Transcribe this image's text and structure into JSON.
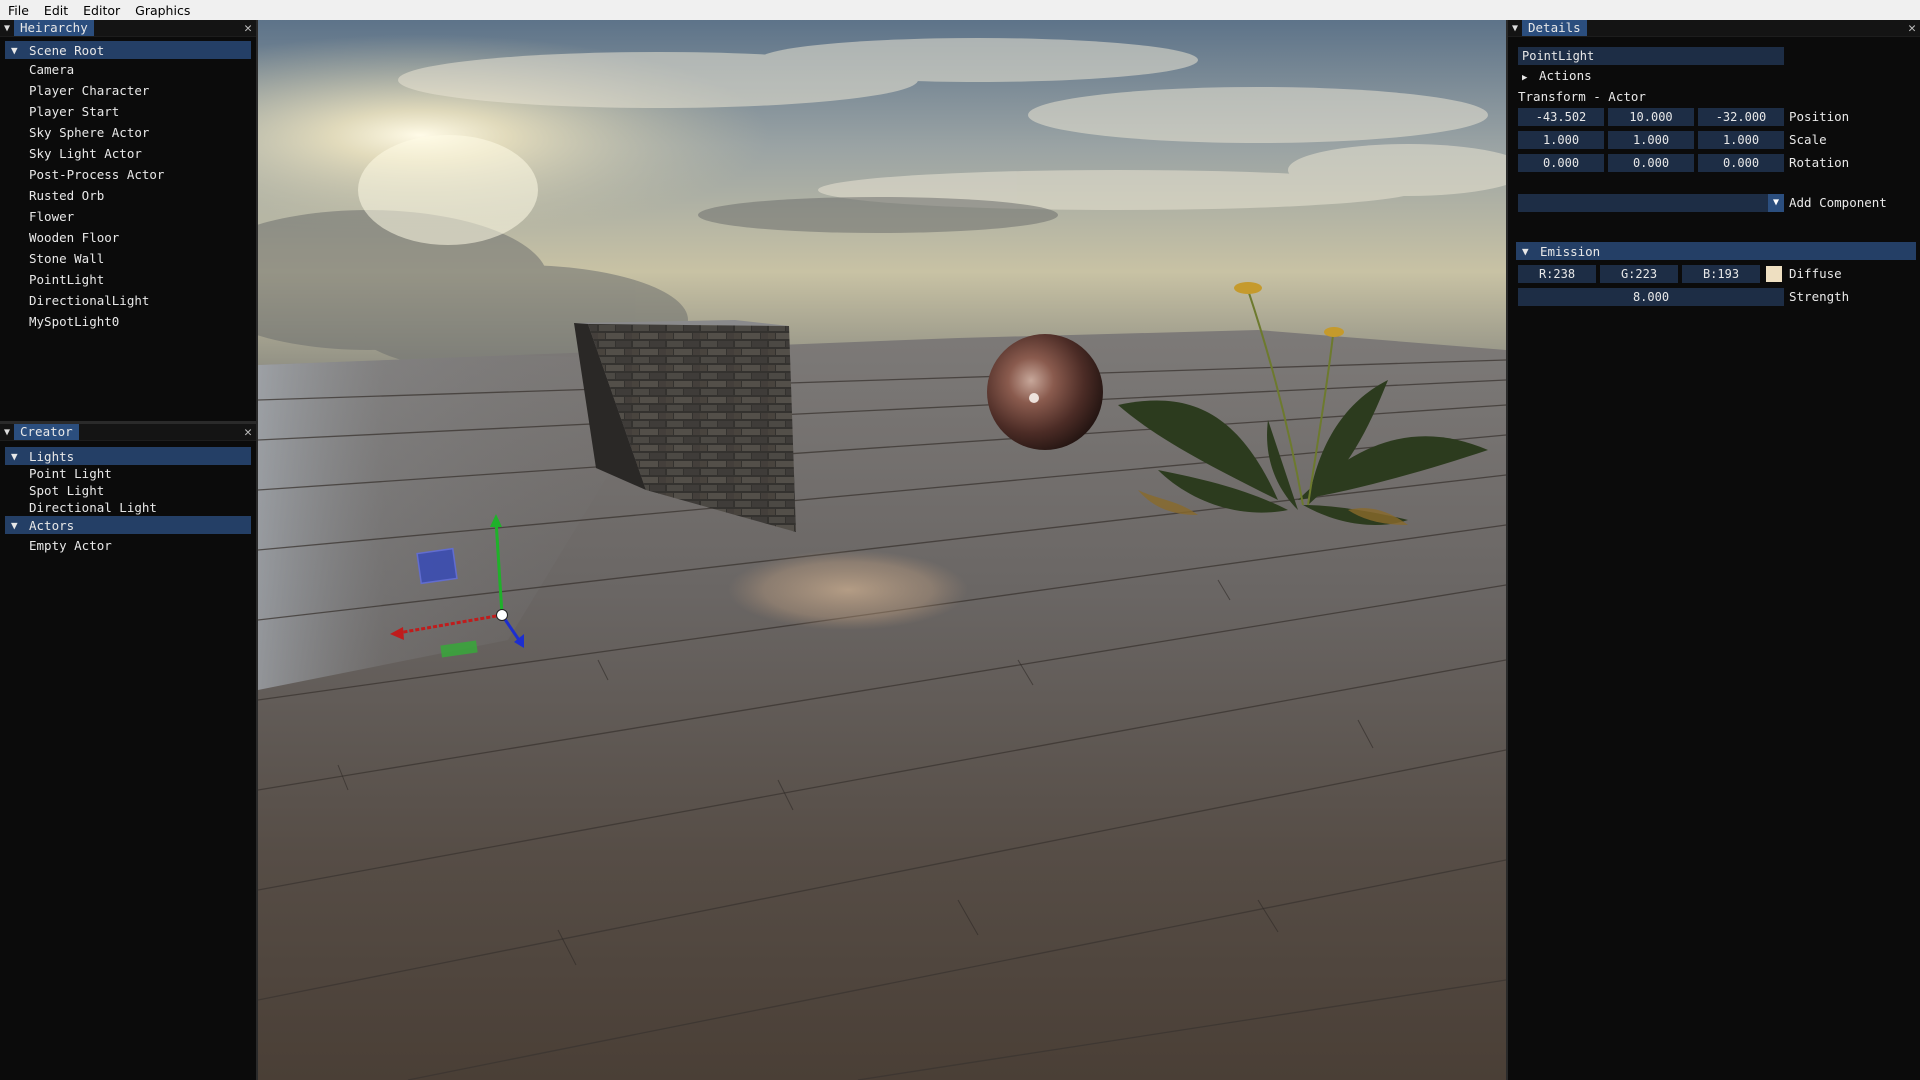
{
  "menu": {
    "items": [
      "File",
      "Edit",
      "Editor",
      "Graphics"
    ]
  },
  "hierarchy": {
    "title": "Heirarchy",
    "root_label": "Scene Root",
    "items": [
      "Camera",
      "Player Character",
      "Player Start",
      "Sky Sphere Actor",
      "Sky Light Actor",
      "Post-Process Actor",
      "Rusted Orb",
      "Flower",
      "Wooden Floor",
      "Stone Wall",
      "PointLight",
      "DirectionalLight",
      "MySpotLight0"
    ]
  },
  "creator": {
    "title": "Creator",
    "lights_label": "Lights",
    "lights": [
      "Point Light",
      "Spot Light",
      "Directional Light"
    ],
    "actors_label": "Actors",
    "actors": [
      "Empty Actor"
    ]
  },
  "details": {
    "title": "Details",
    "name": "PointLight",
    "actions_label": "Actions",
    "transform_label": "Transform - Actor",
    "position": {
      "x": "-43.502",
      "y": "10.000",
      "z": "-32.000",
      "label": "Position"
    },
    "scale": {
      "x": "1.000",
      "y": "1.000",
      "z": "1.000",
      "label": "Scale"
    },
    "rotation": {
      "x": "0.000",
      "y": "0.000",
      "z": "0.000",
      "label": "Rotation"
    },
    "add_component_label": "Add Component",
    "emission": {
      "label": "Emission",
      "r": "R:238",
      "g": "G:223",
      "b": "B:193",
      "diffuse_label": "Diffuse",
      "diffuse_color": "#eedfc1",
      "strength": "8.000",
      "strength_label": "Strength"
    }
  },
  "icons": {
    "collapse": "triangle-down-icon",
    "close": "close-icon",
    "expand": "triangle-right-icon"
  }
}
